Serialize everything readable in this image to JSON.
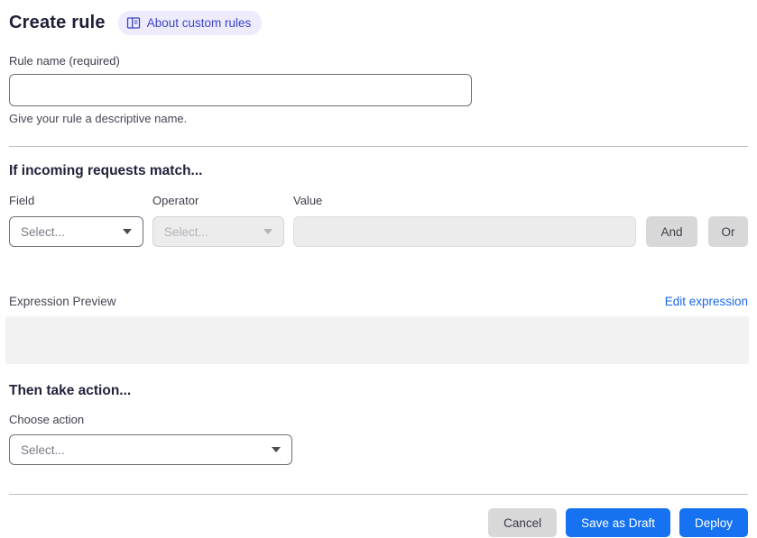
{
  "header": {
    "title": "Create rule",
    "badge": {
      "label": "About custom rules",
      "icon": "docs-icon"
    }
  },
  "rule_name": {
    "label": "Rule name (required)",
    "value": "",
    "helper": "Give your rule a descriptive name."
  },
  "match_section": {
    "heading": "If incoming requests match...",
    "field": {
      "label": "Field",
      "selected": "Select...",
      "enabled": true
    },
    "operator": {
      "label": "Operator",
      "selected": "Select...",
      "enabled": false
    },
    "value": {
      "label": "Value",
      "value": "",
      "enabled": false
    },
    "and_button": "And",
    "or_button": "Or"
  },
  "expression": {
    "label": "Expression Preview",
    "edit_link": "Edit expression",
    "content": ""
  },
  "action_section": {
    "heading": "Then take action...",
    "choose_label": "Choose action",
    "selected": "Select..."
  },
  "footer": {
    "cancel": "Cancel",
    "save_draft": "Save as Draft",
    "deploy": "Deploy"
  },
  "colors": {
    "primary_blue": "#1672f0",
    "link_blue": "#1b66e8",
    "badge_bg": "#edebfc",
    "badge_text": "#3b45c4",
    "disabled_bg": "#ececec",
    "neutral_button_bg": "#d8d8d9",
    "divider": "#bdbdc2",
    "expression_box_bg": "#f2f2f2"
  }
}
